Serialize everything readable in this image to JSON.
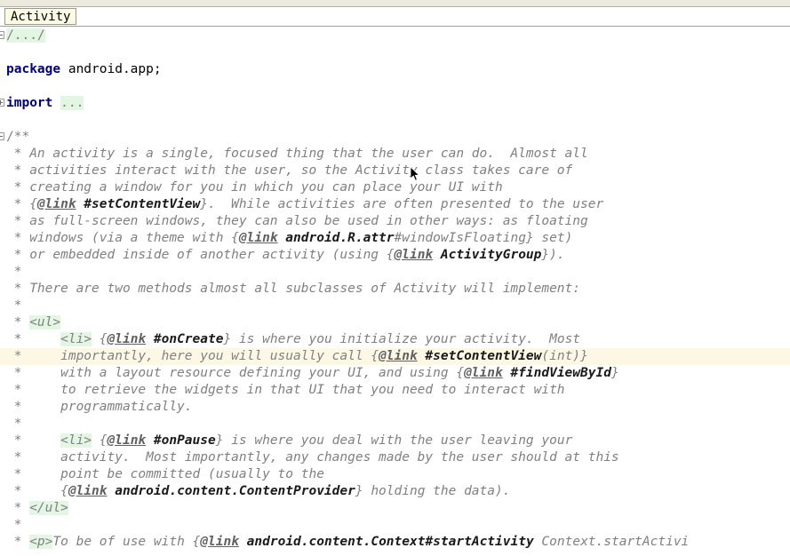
{
  "window": {
    "title": "Activity"
  },
  "tabs": [
    {
      "label": "Activity",
      "active": true
    }
  ],
  "editor": {
    "caret_line_index": 17,
    "colors": {
      "keyword": "#000080",
      "comment": "#808080",
      "fold_background": "#e3f5e3",
      "caret_line_background": "#fdf8e6",
      "tab_background": "#fbfbe3",
      "reference": "#1a1a1a",
      "background": "#ffffff"
    },
    "lines": [
      {
        "id": "line-collapsed-license",
        "fold": "minus",
        "tokens": [
          {
            "t": "/.../",
            "c": "fold"
          }
        ]
      },
      {
        "id": "line-blank-1",
        "tokens": [
          {
            "t": "",
            "c": "cmt"
          }
        ]
      },
      {
        "id": "line-package",
        "tokens": [
          {
            "t": "package",
            "c": "kw"
          },
          {
            "t": " android.app;",
            "c": "plain"
          }
        ]
      },
      {
        "id": "line-blank-2",
        "tokens": [
          {
            "t": "",
            "c": "cmt"
          }
        ]
      },
      {
        "id": "line-import",
        "fold": "plus",
        "tokens": [
          {
            "t": "import",
            "c": "kw"
          },
          {
            "t": " ",
            "c": "plain"
          },
          {
            "t": "...",
            "c": "fold"
          }
        ]
      },
      {
        "id": "line-blank-3",
        "tokens": [
          {
            "t": "",
            "c": "cmt"
          }
        ]
      },
      {
        "id": "line-javadoc-open",
        "fold": "minus",
        "tokens": [
          {
            "t": "/**",
            "c": "cmt-up"
          }
        ]
      },
      {
        "id": "line-doc-1",
        "tokens": [
          {
            "t": " * An activity is a single, focused thing that the user can do.  Almost all",
            "c": "cmt"
          }
        ]
      },
      {
        "id": "line-doc-2",
        "tokens": [
          {
            "t": " * activities interact with the user, so the Activity class takes care of",
            "c": "cmt"
          }
        ]
      },
      {
        "id": "line-doc-3",
        "tokens": [
          {
            "t": " * creating a window for you in which you can place your UI with",
            "c": "cmt"
          }
        ]
      },
      {
        "id": "line-doc-4",
        "tokens": [
          {
            "t": " * {",
            "c": "brace"
          },
          {
            "t": "@link",
            "c": "taglink"
          },
          {
            "t": " ",
            "c": "cmt"
          },
          {
            "t": "#setContentView",
            "c": "ref"
          },
          {
            "t": "}.  While activities are often presented to the user",
            "c": "cmt"
          }
        ]
      },
      {
        "id": "line-doc-5",
        "tokens": [
          {
            "t": " * as full-screen windows, they can also be used in other ways: as floating",
            "c": "cmt"
          }
        ]
      },
      {
        "id": "line-doc-6",
        "tokens": [
          {
            "t": " * windows (via a theme with {",
            "c": "cmt"
          },
          {
            "t": "@link",
            "c": "taglink"
          },
          {
            "t": " ",
            "c": "cmt"
          },
          {
            "t": "android.R.attr",
            "c": "ref"
          },
          {
            "t": "#windowIsFloating} set)",
            "c": "cmt"
          }
        ]
      },
      {
        "id": "line-doc-7",
        "tokens": [
          {
            "t": " * or embedded inside of another activity (using {",
            "c": "cmt"
          },
          {
            "t": "@link",
            "c": "taglink"
          },
          {
            "t": " ",
            "c": "cmt"
          },
          {
            "t": "ActivityGroup",
            "c": "ref"
          },
          {
            "t": "}).",
            "c": "cmt"
          }
        ]
      },
      {
        "id": "line-doc-8",
        "tokens": [
          {
            "t": " *",
            "c": "cmt"
          }
        ]
      },
      {
        "id": "line-doc-9",
        "tokens": [
          {
            "t": " * There are two methods almost all subclasses of Activity will implement:",
            "c": "cmt"
          }
        ]
      },
      {
        "id": "line-doc-10",
        "tokens": [
          {
            "t": " *",
            "c": "cmt"
          }
        ]
      },
      {
        "id": "line-doc-ul-open",
        "tokens": [
          {
            "t": " * ",
            "c": "cmt"
          },
          {
            "t": "<ul>",
            "c": "htmltag"
          }
        ]
      },
      {
        "id": "line-doc-li-oncreate",
        "tokens": [
          {
            "t": " *     ",
            "c": "cmt"
          },
          {
            "t": "<li>",
            "c": "htmltag"
          },
          {
            "t": " {",
            "c": "cmt"
          },
          {
            "t": "@link",
            "c": "taglink"
          },
          {
            "t": " ",
            "c": "cmt"
          },
          {
            "t": "#onCreate",
            "c": "ref"
          },
          {
            "t": "} is where you initialize your activity.  Most",
            "c": "cmt"
          }
        ]
      },
      {
        "id": "line-doc-li-oncreate-2",
        "caret": true,
        "tokens": [
          {
            "t": " *     importantly, here you will usually call {",
            "c": "cmt"
          },
          {
            "t": "@link",
            "c": "taglink"
          },
          {
            "t": " ",
            "c": "cmt"
          },
          {
            "t": "#setContentView",
            "c": "ref"
          },
          {
            "t": "(int)}",
            "c": "cmt"
          }
        ]
      },
      {
        "id": "line-doc-li-oncreate-3",
        "tokens": [
          {
            "t": " *     with a layout resource defining your UI, and using {",
            "c": "cmt"
          },
          {
            "t": "@link",
            "c": "taglink"
          },
          {
            "t": " ",
            "c": "cmt"
          },
          {
            "t": "#findViewById",
            "c": "ref"
          },
          {
            "t": "}",
            "c": "cmt"
          }
        ]
      },
      {
        "id": "line-doc-li-oncreate-4",
        "tokens": [
          {
            "t": " *     to retrieve the widgets in that UI that you need to interact with",
            "c": "cmt"
          }
        ]
      },
      {
        "id": "line-doc-li-oncreate-5",
        "tokens": [
          {
            "t": " *     programmatically.",
            "c": "cmt"
          }
        ]
      },
      {
        "id": "line-doc-11",
        "tokens": [
          {
            "t": " *",
            "c": "cmt"
          }
        ]
      },
      {
        "id": "line-doc-li-onpause",
        "tokens": [
          {
            "t": " *     ",
            "c": "cmt"
          },
          {
            "t": "<li>",
            "c": "htmltag"
          },
          {
            "t": " {",
            "c": "cmt"
          },
          {
            "t": "@link",
            "c": "taglink"
          },
          {
            "t": " ",
            "c": "cmt"
          },
          {
            "t": "#onPause",
            "c": "ref"
          },
          {
            "t": "} is where you deal with the user leaving your",
            "c": "cmt"
          }
        ]
      },
      {
        "id": "line-doc-li-onpause-2",
        "tokens": [
          {
            "t": " *     activity.  Most importantly, any changes made by the user should at this",
            "c": "cmt"
          }
        ]
      },
      {
        "id": "line-doc-li-onpause-3",
        "tokens": [
          {
            "t": " *     point be committed (usually to the",
            "c": "cmt"
          }
        ]
      },
      {
        "id": "line-doc-li-onpause-4",
        "tokens": [
          {
            "t": " *     {",
            "c": "cmt"
          },
          {
            "t": "@link",
            "c": "taglink"
          },
          {
            "t": " ",
            "c": "cmt"
          },
          {
            "t": "android.content.ContentProvider",
            "c": "ref"
          },
          {
            "t": "} holding the data).",
            "c": "cmt"
          }
        ]
      },
      {
        "id": "line-doc-ul-close",
        "tokens": [
          {
            "t": " * ",
            "c": "cmt"
          },
          {
            "t": "</ul>",
            "c": "htmltag"
          }
        ]
      },
      {
        "id": "line-doc-12",
        "tokens": [
          {
            "t": " *",
            "c": "cmt"
          }
        ]
      },
      {
        "id": "line-doc-p-start",
        "tokens": [
          {
            "t": " * ",
            "c": "cmt"
          },
          {
            "t": "<p>",
            "c": "htmltag"
          },
          {
            "t": "To be of use with {",
            "c": "cmt"
          },
          {
            "t": "@link",
            "c": "taglink"
          },
          {
            "t": " ",
            "c": "cmt"
          },
          {
            "t": "android.content.Context#startActivity",
            "c": "ref"
          },
          {
            "t": " Context.startActivi",
            "c": "cmt"
          }
        ]
      }
    ]
  }
}
